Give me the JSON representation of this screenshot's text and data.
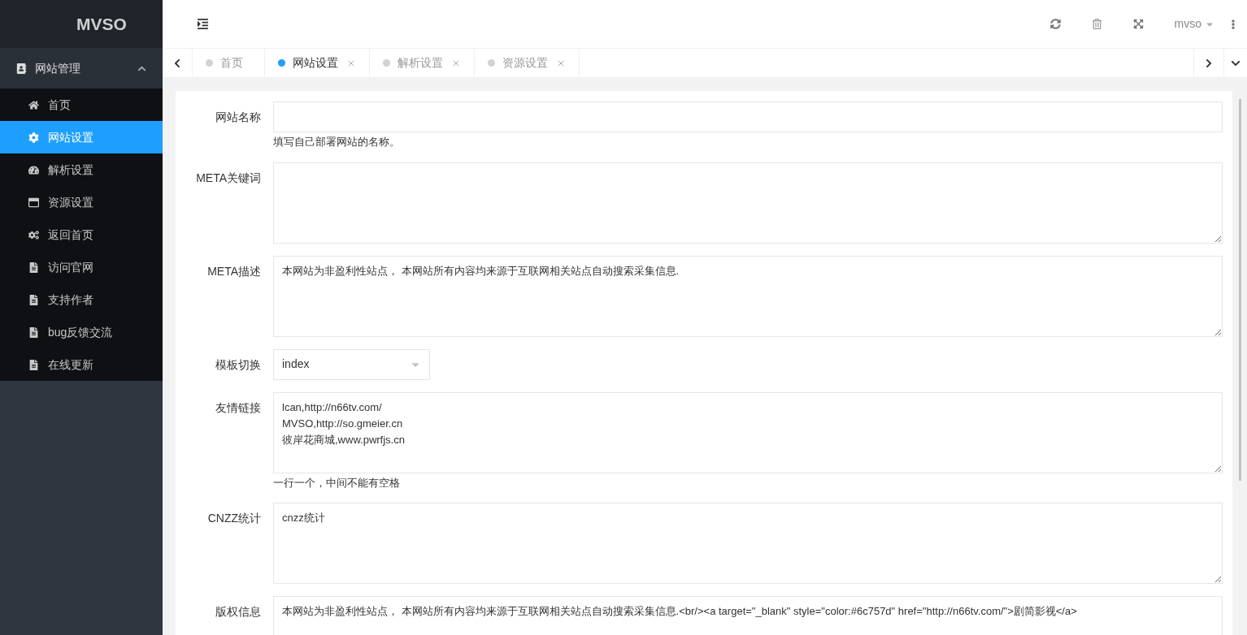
{
  "logo": {
    "text": "MVSO"
  },
  "sidebar": {
    "group": {
      "label": "网站管理",
      "expanded": true
    },
    "items": [
      {
        "label": "首页",
        "selected": false
      },
      {
        "label": "网站设置",
        "selected": true
      },
      {
        "label": "解析设置",
        "selected": false
      },
      {
        "label": "资源设置",
        "selected": false
      },
      {
        "label": "返回首页",
        "selected": false
      },
      {
        "label": "访问官网",
        "selected": false
      },
      {
        "label": "支持作者",
        "selected": false
      },
      {
        "label": "bug反馈交流",
        "selected": false
      },
      {
        "label": "在线更新",
        "selected": false
      }
    ]
  },
  "header": {
    "user": "mvso"
  },
  "tabs": [
    {
      "label": "首页",
      "selected": false,
      "closable": false
    },
    {
      "label": "网站设置",
      "selected": true,
      "closable": true
    },
    {
      "label": "解析设置",
      "selected": false,
      "closable": true
    },
    {
      "label": "资源设置",
      "selected": false,
      "closable": true
    }
  ],
  "form": {
    "fields": [
      {
        "kind": "input",
        "label": "网站名称",
        "hint": "填写自己部署网站的名称。"
      },
      {
        "kind": "textarea",
        "label": "META关键词"
      },
      {
        "kind": "textarea",
        "label": "META描述",
        "value": "本网站为非盈利性站点， 本网站所有内容均来源于互联网相关站点自动搜索采集信息."
      },
      {
        "kind": "select",
        "label": "模板切换",
        "value": "index"
      },
      {
        "kind": "textarea",
        "label": "友情链接",
        "value": "lcan,http://n66tv.com/\nMVSO,http://so.gmeier.cn\n彼岸花商城,www.pwrfjs.cn",
        "hint": "一行一个，中间不能有空格"
      },
      {
        "kind": "textarea",
        "label": "CNZZ统计",
        "value": "cnzz统计"
      },
      {
        "kind": "textarea",
        "label": "版权信息",
        "value": "本网站为非盈利性站点， 本网站所有内容均来源于互联网相关站点自动搜索采集信息.<br/><a target=\"_blank\" style=\"color:#6c757d\" href=\"http://n66tv.com/\">剧简影视</a>"
      }
    ]
  }
}
